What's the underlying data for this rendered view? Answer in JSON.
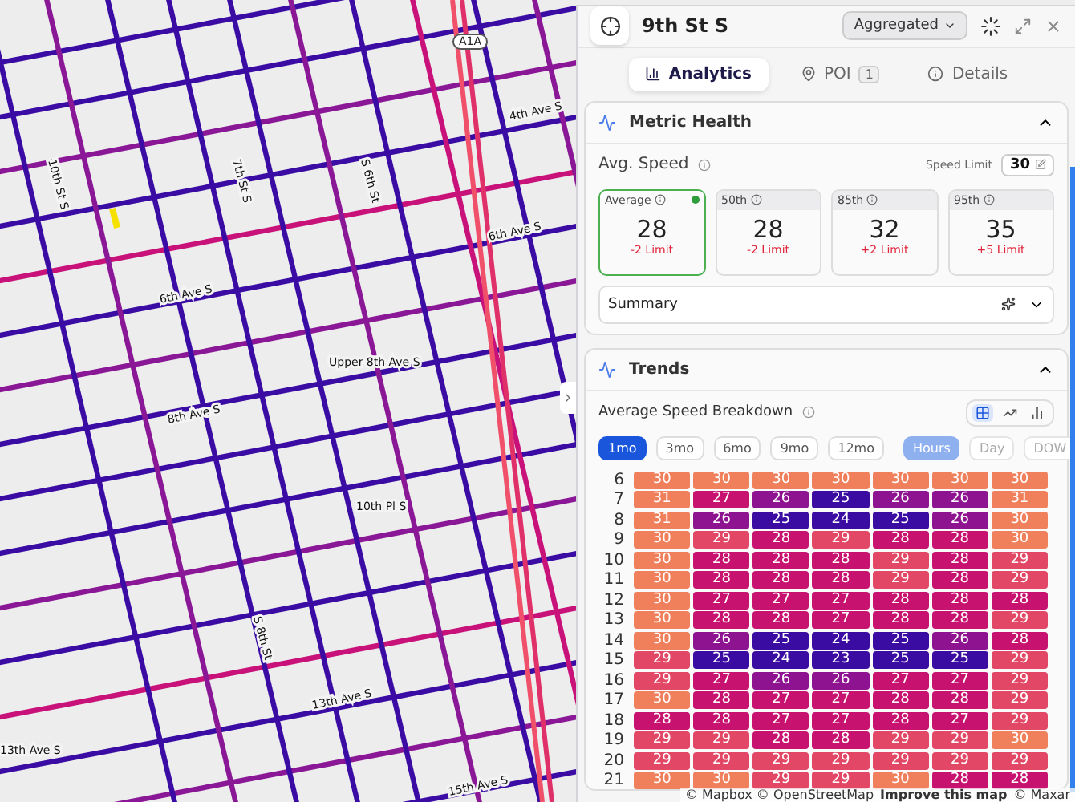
{
  "map": {
    "route_shield": "A1A",
    "labels": [
      "10th St S",
      "7th St S",
      "S 6th St",
      "4th Ave S",
      "6th Ave S",
      "6th Ave S",
      "Upper 8th Ave S",
      "8th Ave S",
      "10th Pl S",
      "S 8th St",
      "13th Ave S",
      "13th Ave S",
      "15th Ave S"
    ],
    "attribution": {
      "sources": "© Mapbox © OpenStreetMap",
      "link": "Improve this map",
      "imagery": "© Maxar"
    }
  },
  "panel": {
    "title": "9th St S",
    "mode": "Aggregated",
    "tabs": [
      {
        "label": "Analytics",
        "selected": true
      },
      {
        "label": "POI",
        "badge": "1",
        "selected": false
      },
      {
        "label": "Details",
        "selected": false
      }
    ],
    "metric_health": {
      "title": "Metric Health",
      "expanded": true,
      "metric": "Avg. Speed",
      "speed_limit_label": "Speed Limit",
      "speed_limit": "30",
      "cards": [
        {
          "label": "Average",
          "value": "28",
          "delta": "-2 Limit",
          "selected": true
        },
        {
          "label": "50th",
          "value": "28",
          "delta": "-2 Limit",
          "selected": false
        },
        {
          "label": "85th",
          "value": "32",
          "delta": "+2 Limit",
          "selected": false
        },
        {
          "label": "95th",
          "value": "35",
          "delta": "+5 Limit",
          "selected": false
        }
      ],
      "summary": {
        "label": "Summary",
        "expanded": false
      }
    },
    "trends": {
      "title": "Trends",
      "expanded": true,
      "chart_title": "Average Speed Breakdown",
      "views": [
        {
          "kind": "grid",
          "selected": true
        },
        {
          "kind": "line",
          "selected": false
        },
        {
          "kind": "bar",
          "selected": false
        }
      ],
      "ranges": [
        {
          "label": "1mo",
          "selected": true
        },
        {
          "label": "3mo",
          "selected": false
        },
        {
          "label": "6mo",
          "selected": false
        },
        {
          "label": "9mo",
          "selected": false
        },
        {
          "label": "12mo",
          "selected": false
        }
      ],
      "groupings": [
        {
          "label": "Hours",
          "selected": true
        },
        {
          "label": "Day",
          "selected": false
        },
        {
          "label": "DOW",
          "selected": false
        }
      ],
      "heatmap": [
        {
          "hour": "6",
          "values": [
            "30",
            "30",
            "30",
            "30",
            "30",
            "30",
            "30"
          ]
        },
        {
          "hour": "7",
          "values": [
            "31",
            "27",
            "26",
            "25",
            "26",
            "26",
            "31"
          ]
        },
        {
          "hour": "8",
          "values": [
            "31",
            "26",
            "25",
            "24",
            "25",
            "26",
            "30"
          ]
        },
        {
          "hour": "9",
          "values": [
            "30",
            "29",
            "28",
            "29",
            "28",
            "28",
            "30"
          ]
        },
        {
          "hour": "10",
          "values": [
            "30",
            "28",
            "28",
            "28",
            "29",
            "28",
            "29"
          ]
        },
        {
          "hour": "11",
          "values": [
            "30",
            "28",
            "28",
            "28",
            "29",
            "28",
            "29"
          ]
        },
        {
          "hour": "12",
          "values": [
            "30",
            "27",
            "27",
            "27",
            "28",
            "28",
            "28"
          ]
        },
        {
          "hour": "13",
          "values": [
            "30",
            "28",
            "28",
            "27",
            "28",
            "28",
            "29"
          ]
        },
        {
          "hour": "14",
          "values": [
            "30",
            "26",
            "25",
            "24",
            "25",
            "26",
            "28"
          ]
        },
        {
          "hour": "15",
          "values": [
            "29",
            "25",
            "24",
            "23",
            "25",
            "25",
            "29"
          ]
        },
        {
          "hour": "16",
          "values": [
            "29",
            "27",
            "26",
            "26",
            "27",
            "27",
            "29"
          ]
        },
        {
          "hour": "17",
          "values": [
            "30",
            "28",
            "27",
            "27",
            "28",
            "28",
            "29"
          ]
        },
        {
          "hour": "18",
          "values": [
            "28",
            "28",
            "27",
            "27",
            "28",
            "27",
            "29"
          ]
        },
        {
          "hour": "19",
          "values": [
            "29",
            "29",
            "28",
            "28",
            "29",
            "29",
            "30"
          ]
        },
        {
          "hour": "20",
          "values": [
            "29",
            "29",
            "29",
            "29",
            "29",
            "29",
            "29"
          ]
        },
        {
          "hour": "21",
          "values": [
            "30",
            "30",
            "29",
            "29",
            "30",
            "28",
            "28"
          ]
        }
      ]
    }
  }
}
